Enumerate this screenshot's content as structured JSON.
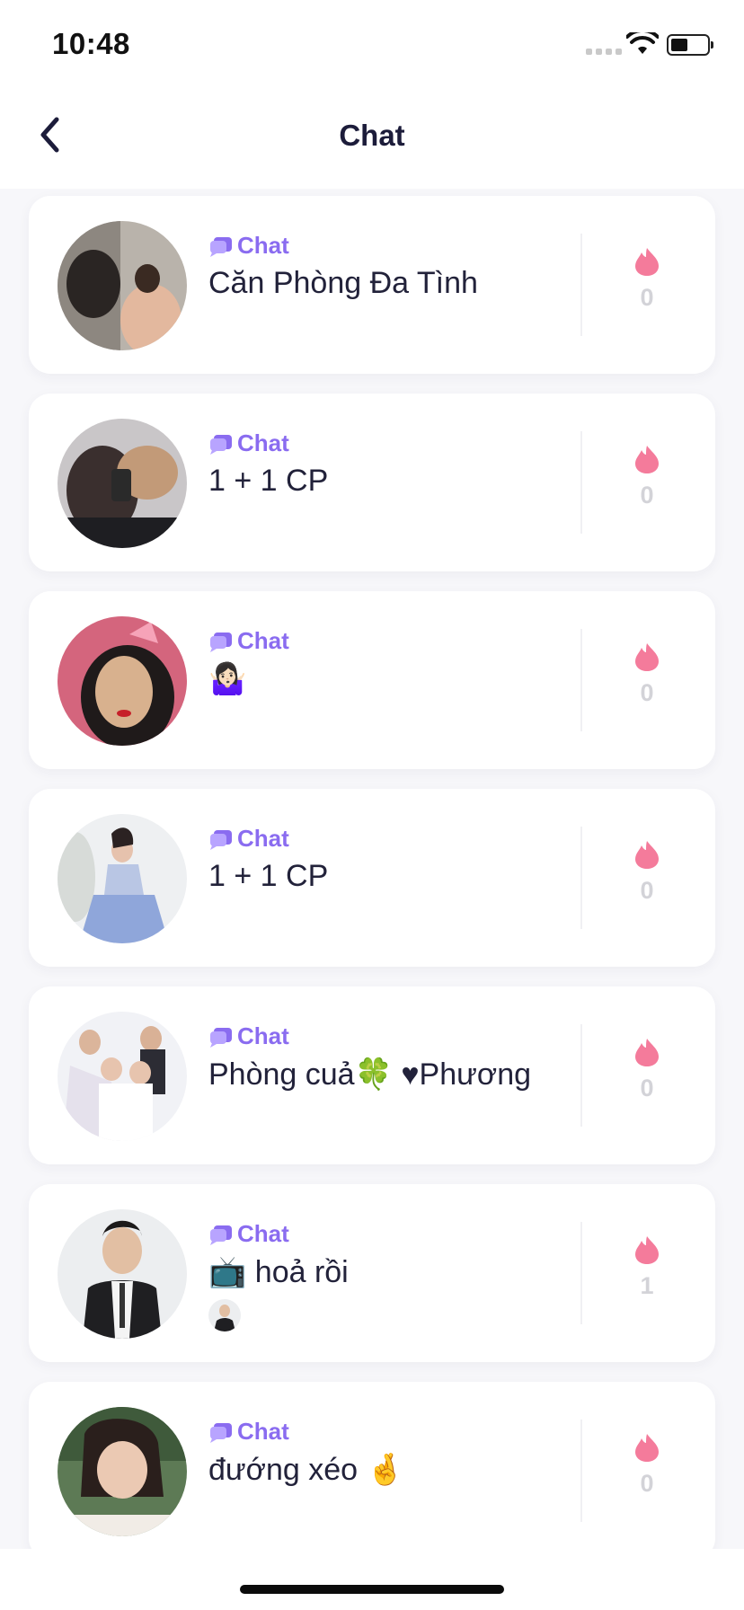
{
  "status_bar": {
    "time": "10:48"
  },
  "header": {
    "title": "Chat"
  },
  "rooms": [
    {
      "tag": "Chat",
      "name": "Căn Phòng Đa Tình",
      "heat": "0"
    },
    {
      "tag": "Chat",
      "name": "1 + 1 CP",
      "heat": "0"
    },
    {
      "tag": "Chat",
      "name": "🤷🏻‍♀️",
      "heat": "0"
    },
    {
      "tag": "Chat",
      "name": "1 + 1 CP",
      "heat": "0"
    },
    {
      "tag": "Chat",
      "name": "Phòng cuả🍀 ♥Phương",
      "heat": "0"
    },
    {
      "tag": "Chat",
      "name": "📺 hoả rồi",
      "heat": "1"
    },
    {
      "tag": "Chat",
      "name": "đướng xéo 🤞",
      "heat": "0"
    }
  ],
  "colors": {
    "accent": "#8a6cf0",
    "flame": "#f47b9b",
    "count": "#d3d3d8"
  },
  "icons": {
    "back": "chevron-left-icon",
    "tag": "chat-bubble-icon",
    "heat": "flame-icon"
  }
}
